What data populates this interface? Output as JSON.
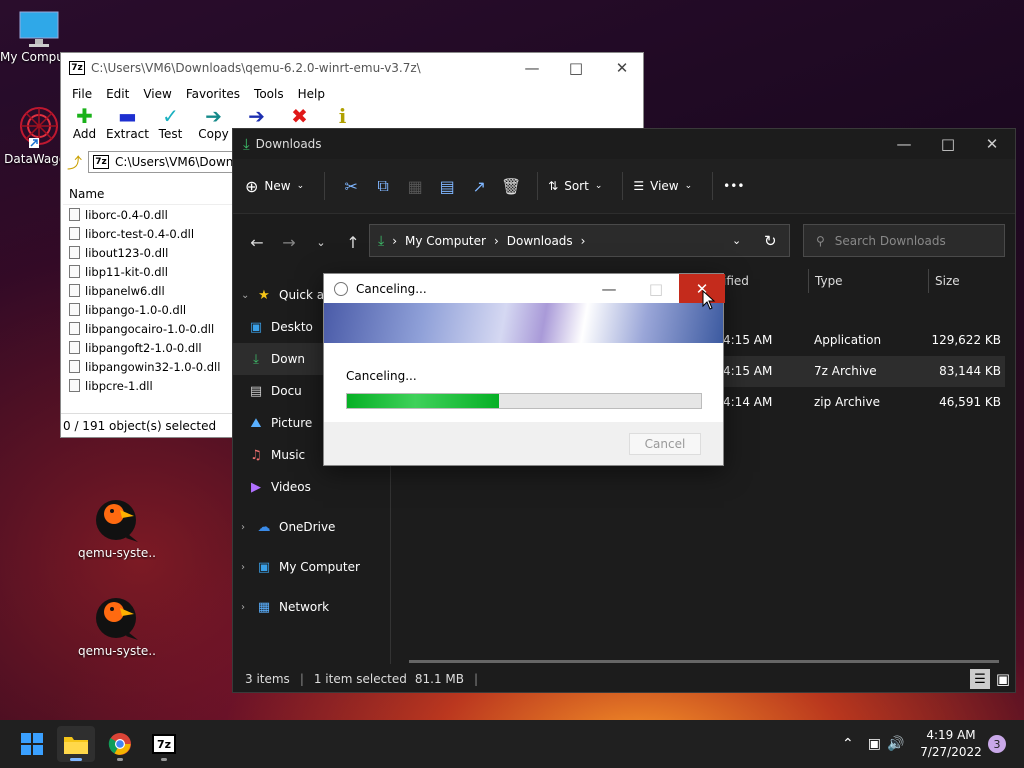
{
  "desktop": {
    "icons": [
      {
        "label": "My Computer"
      },
      {
        "label": "DataWagon"
      },
      {
        "label": "qemu-syste..."
      },
      {
        "label": "qemu-syste..."
      }
    ]
  },
  "sevenzip": {
    "title": "C:\\Users\\VM6\\Downloads\\qemu-6.2.0-winrt-emu-v3.7z\\",
    "badge": "7z",
    "menu": [
      "File",
      "Edit",
      "View",
      "Favorites",
      "Tools",
      "Help"
    ],
    "toolbar": [
      "Add",
      "Extract",
      "Test",
      "Copy"
    ],
    "address": "C:\\Users\\VM6\\Downloads\\qemu-6.2.0-winrt-emu-v3.7z\\",
    "column_name": "Name",
    "files": [
      "liborc-0.4-0.dll",
      "liborc-test-0.4-0.dll",
      "libout123-0.dll",
      "libp11-kit-0.dll",
      "libpanelw6.dll",
      "libpango-1.0-0.dll",
      "libpangocairo-1.0-0.dll",
      "libpangoft2-1.0-0.dll",
      "libpangowin32-1.0-0.dll",
      "libpcre-1.dll"
    ],
    "status": "0 / 191 object(s) selected"
  },
  "explorer": {
    "title": "Downloads",
    "cmd": {
      "new": "New",
      "sort": "Sort",
      "view": "View",
      "more": "•••"
    },
    "breadcrumb": [
      "My Computer",
      "Downloads"
    ],
    "search_placeholder": "Search Downloads",
    "columns": {
      "modified": "ified",
      "type": "Type",
      "size": "Size"
    },
    "rows": [
      {
        "time": "4:15 AM",
        "type": "Application",
        "size": "129,622 KB"
      },
      {
        "time": "4:15 AM",
        "type": "7z Archive",
        "size": "83,144 KB"
      },
      {
        "time": "4:14 AM",
        "type": "zip Archive",
        "size": "46,591 KB"
      }
    ],
    "sidebar": {
      "quick_access": "Quick a",
      "desktop": "Deskto",
      "downloads": "Down",
      "documents": "Docu",
      "pictures": "Picture",
      "music": "Music",
      "videos": "Videos",
      "onedrive": "OneDrive",
      "mycomputer": "My Computer",
      "network": "Network"
    },
    "status": {
      "items": "3 items",
      "selected": "1 item selected",
      "size": "81.1 MB"
    }
  },
  "dialog": {
    "title": "Canceling...",
    "message": "Canceling...",
    "progress": 0.43,
    "cancel": "Cancel"
  },
  "taskbar": {
    "badge": "7z",
    "time": "4:19 AM",
    "date": "7/27/2022",
    "notifications": "3"
  },
  "colors": {
    "accent": "#0078d4",
    "progress": "#06b025",
    "close_hover": "#c42b1c"
  }
}
